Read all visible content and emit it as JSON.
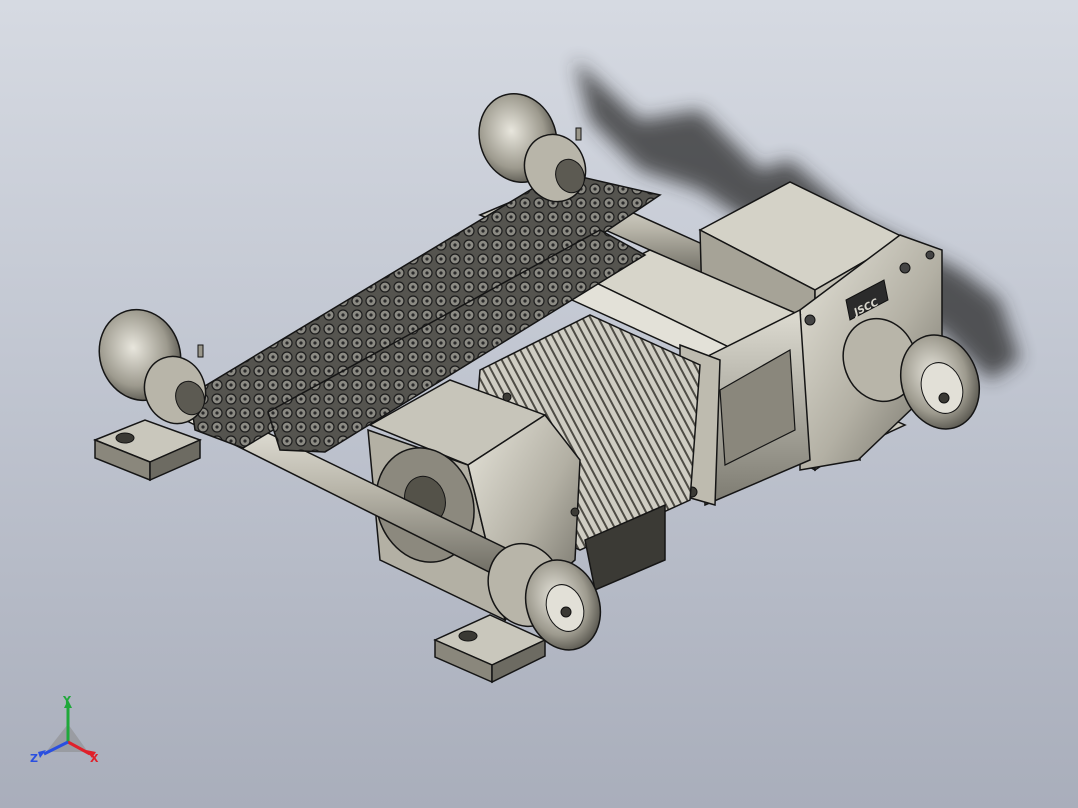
{
  "brand": {
    "logo_text": "JSCC"
  },
  "triad": {
    "x_label": "X",
    "y_label": "Y",
    "z_label": "Z",
    "x_color": "#e0202a",
    "y_color": "#1fa83a",
    "z_color": "#2a4fe0"
  },
  "palette": {
    "metal_light": "#d9d7cc",
    "metal_mid": "#a9a69a",
    "metal_dark": "#5a5850",
    "chain": "#6c6b66",
    "edge": "#151515"
  },
  "icons": [
    "coordinate-triad-icon"
  ]
}
